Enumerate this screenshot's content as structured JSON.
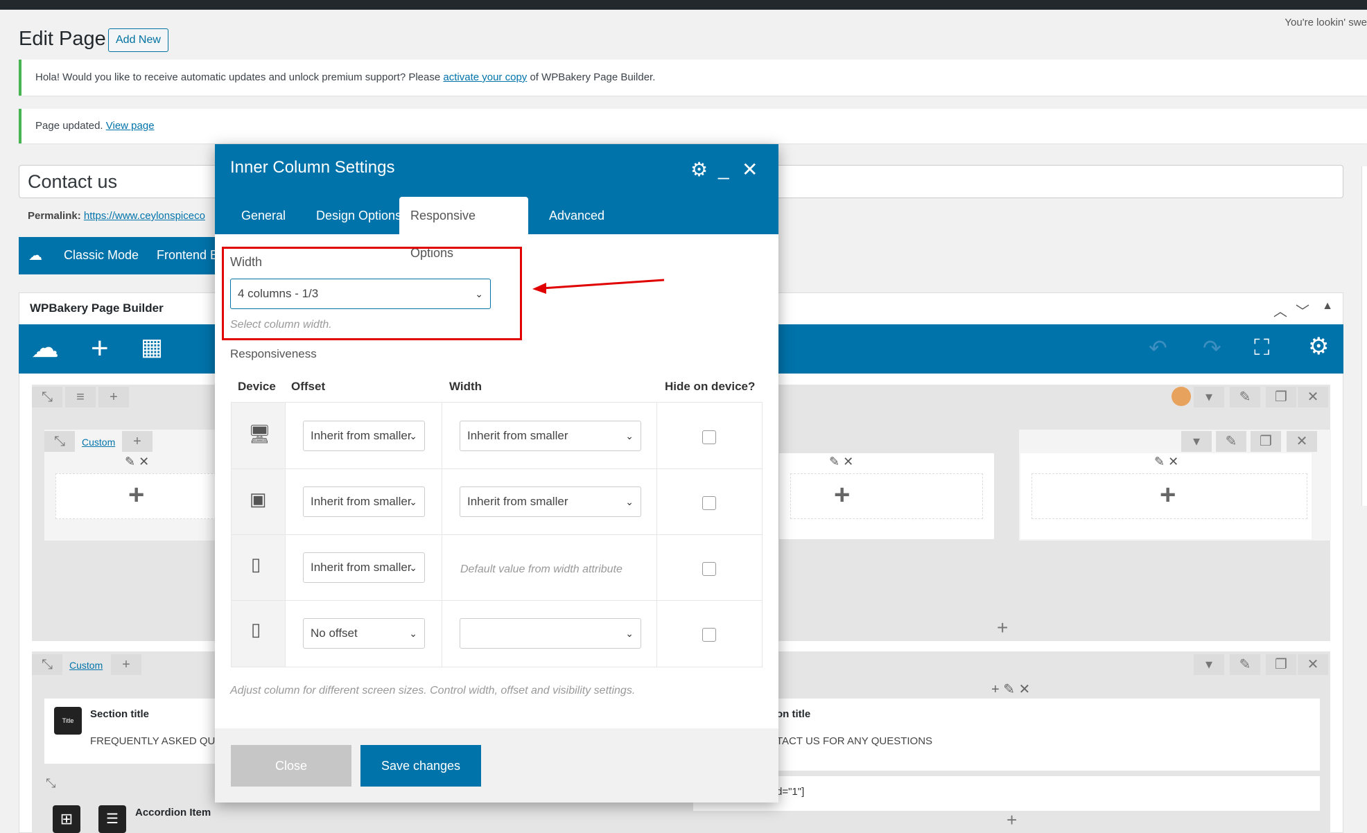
{
  "admin_bar": {
    "greeting": "You're lookin' swe"
  },
  "page": {
    "title": "Edit Page",
    "add_new": "Add New"
  },
  "notices": {
    "update_text": "Hola! Would you like to receive automatic updates and unlock premium support? Please",
    "update_link": "activate your copy",
    "update_suffix": "of WPBakery Page Builder.",
    "updated_text": "Page updated.",
    "updated_link": "View page"
  },
  "post": {
    "title": "Contact us",
    "permalink_label": "Permalink:",
    "permalink_url": "https://www.ceylonspiceco"
  },
  "mode_bar": {
    "classic": "Classic Mode",
    "frontend": "Frontend E"
  },
  "builder": {
    "header": "WPBakery Page Builder",
    "custom_label": "Custom",
    "section_title": "Section title",
    "faq_text": "FREQUENTLY ASKED QUE",
    "accordion_item": "Accordion Item",
    "right_section_title": "on title",
    "right_contact": "TACT US FOR ANY QUESTIONS",
    "shortcode_frag": "d=\"1\"]"
  },
  "modal": {
    "title": "Inner Column Settings",
    "tabs": [
      "General",
      "Design Options",
      "Responsive Options",
      "Advanced"
    ],
    "active_tab": "Responsive Options",
    "width_label": "Width",
    "width_value": "4 columns - 1/3",
    "width_hint": "Select column width.",
    "responsiveness_label": "Responsiveness",
    "col_device": "Device",
    "col_offset": "Offset",
    "col_width": "Width",
    "col_hide": "Hide on device?",
    "rows": [
      {
        "device_icon": "desktop-icon",
        "offset": "Inherit from smaller",
        "width": "Inherit from smaller",
        "hide": false
      },
      {
        "device_icon": "tablet-landscape-icon",
        "offset": "Inherit from smaller",
        "width": "Inherit from smaller",
        "hide": false
      },
      {
        "device_icon": "tablet-portrait-icon",
        "offset": "Inherit from smaller",
        "width": "Default value from width attribute",
        "hide": false
      },
      {
        "device_icon": "mobile-icon",
        "offset": "No offset",
        "width": "",
        "hide": false
      }
    ],
    "footer_hint": "Adjust column for different screen sizes. Control width, offset and visibility settings.",
    "close_button": "Close",
    "save_button": "Save changes"
  },
  "colors": {
    "primary": "#0073aa",
    "highlight": "#e00000",
    "notice_border": "#46b450"
  }
}
